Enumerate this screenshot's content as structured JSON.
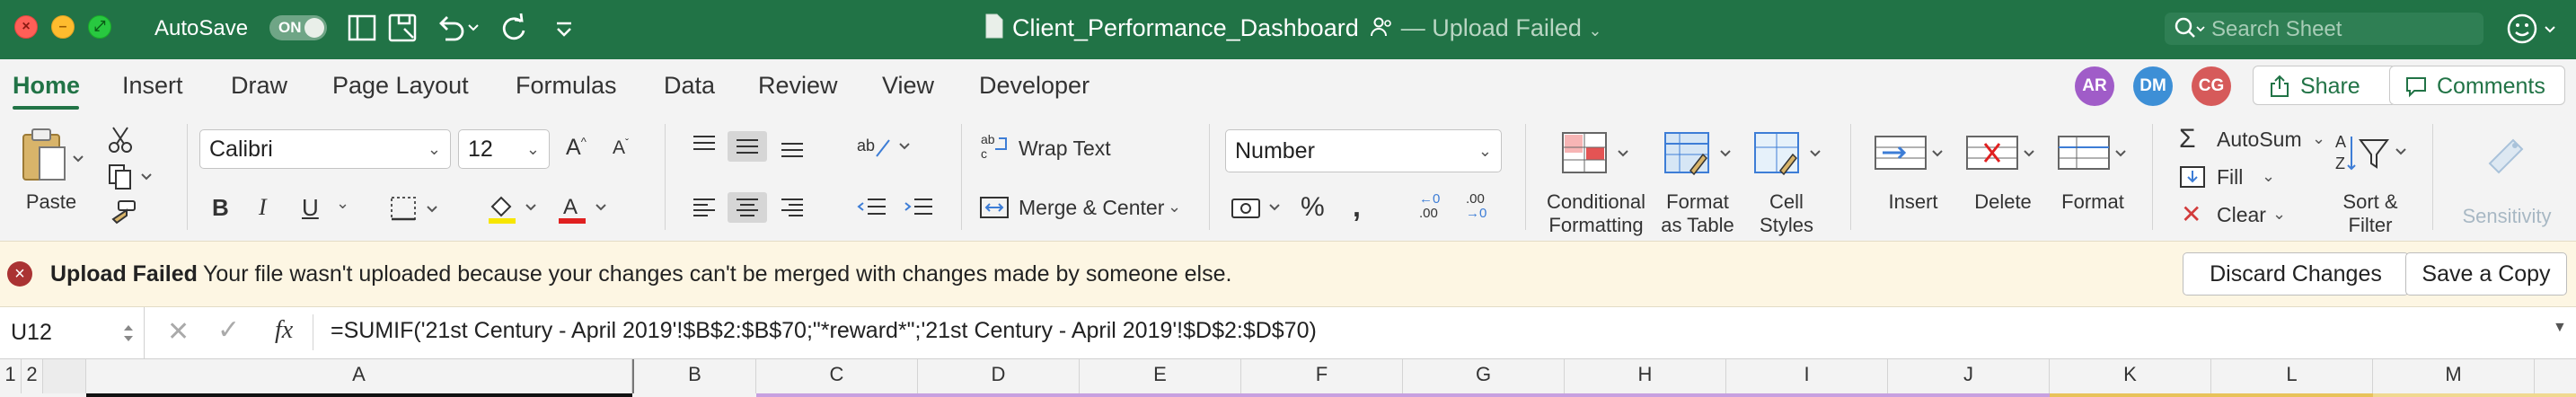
{
  "window": {
    "autosave_label": "AutoSave",
    "autosave_state": "ON",
    "doc_title": "Client_Performance_Dashboard",
    "title_separator": "—",
    "upload_status": "Upload Failed",
    "search_placeholder": "Search Sheet"
  },
  "tabs": [
    "Home",
    "Insert",
    "Draw",
    "Page Layout",
    "Formulas",
    "Data",
    "Review",
    "View",
    "Developer"
  ],
  "active_tab": "Home",
  "collaborators": [
    {
      "initials": "AR",
      "color": "#a05cc8"
    },
    {
      "initials": "DM",
      "color": "#3d8fd6"
    },
    {
      "initials": "CG",
      "color": "#d65a5a"
    }
  ],
  "actions": {
    "share": "Share",
    "comments": "Comments"
  },
  "ribbon": {
    "paste": "Paste",
    "font_name": "Calibri",
    "font_size": "12",
    "wrap_text": "Wrap Text",
    "merge_center": "Merge & Center",
    "number_format": "Number",
    "conditional_1": "Conditional",
    "conditional_2": "Formatting",
    "format_table_1": "Format",
    "format_table_2": "as Table",
    "cell_styles_1": "Cell",
    "cell_styles_2": "Styles",
    "insert": "Insert",
    "delete": "Delete",
    "format": "Format",
    "autosum": "AutoSum",
    "fill": "Fill",
    "clear": "Clear",
    "sort_filter_1": "Sort &",
    "sort_filter_2": "Filter",
    "sensitivity": "Sensitivity"
  },
  "message": {
    "title": "Upload Failed",
    "text": "Your file wasn't uploaded because your changes can't be merged with changes made by someone else.",
    "discard": "Discard Changes",
    "save_copy": "Save a Copy"
  },
  "formula_bar": {
    "cell_ref": "U12",
    "fx": "fx",
    "formula": "=SUMIF('21st Century - April 2019'!$B$2:$B$70;\"*reward*\";'21st Century - April 2019'!$D$2:$D$70)"
  },
  "outline_levels": [
    "1",
    "2"
  ],
  "columns": [
    "A",
    "B",
    "C",
    "D",
    "E",
    "F",
    "G",
    "H",
    "I",
    "J",
    "K",
    "L",
    "M"
  ]
}
